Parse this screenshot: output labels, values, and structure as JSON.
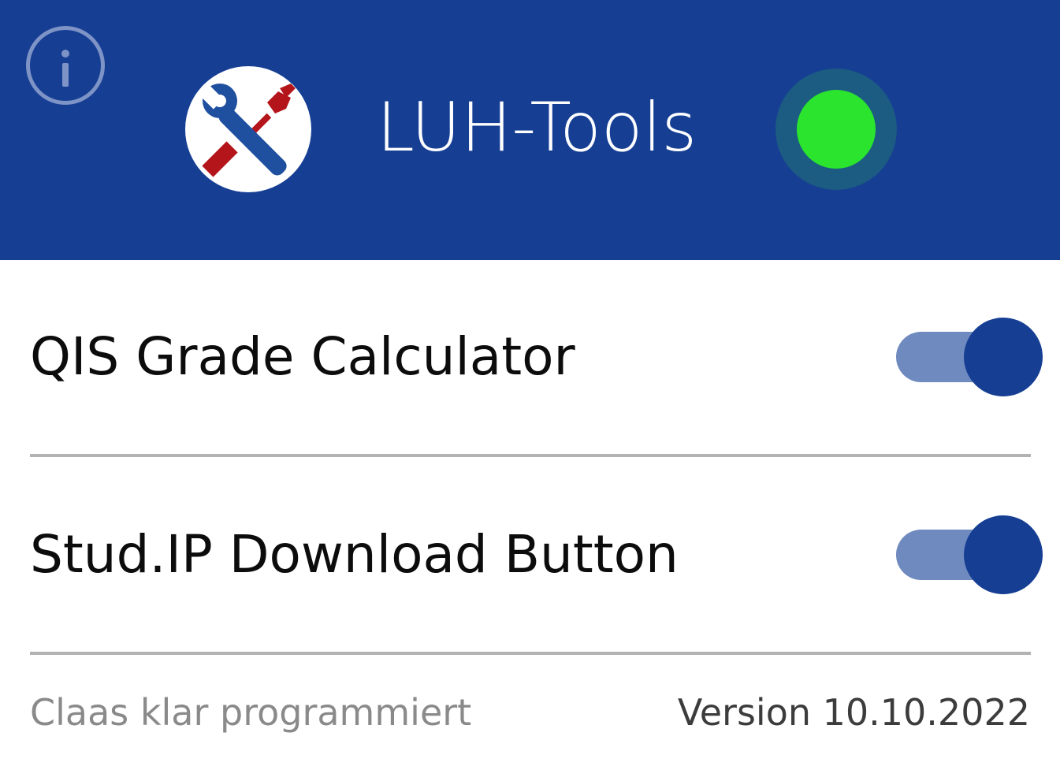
{
  "header": {
    "title": "LUH-Tools",
    "info_icon": "info-icon",
    "logo_icon": "wrench-screwdriver-logo",
    "status": "active",
    "colors": {
      "header_bg": "#163f94",
      "status_ring": "#1c5b82",
      "status_dot": "#2ae42d",
      "logo_red": "#b3151b",
      "logo_blue": "#1f4f9f"
    }
  },
  "settings": {
    "items": [
      {
        "label": "QIS Grade Calculator",
        "enabled": true
      },
      {
        "label": "Stud.IP Download Button",
        "enabled": true
      }
    ]
  },
  "footer": {
    "left_text": "Claas klar programmiert",
    "version_text": "Version 10.10.2022"
  }
}
